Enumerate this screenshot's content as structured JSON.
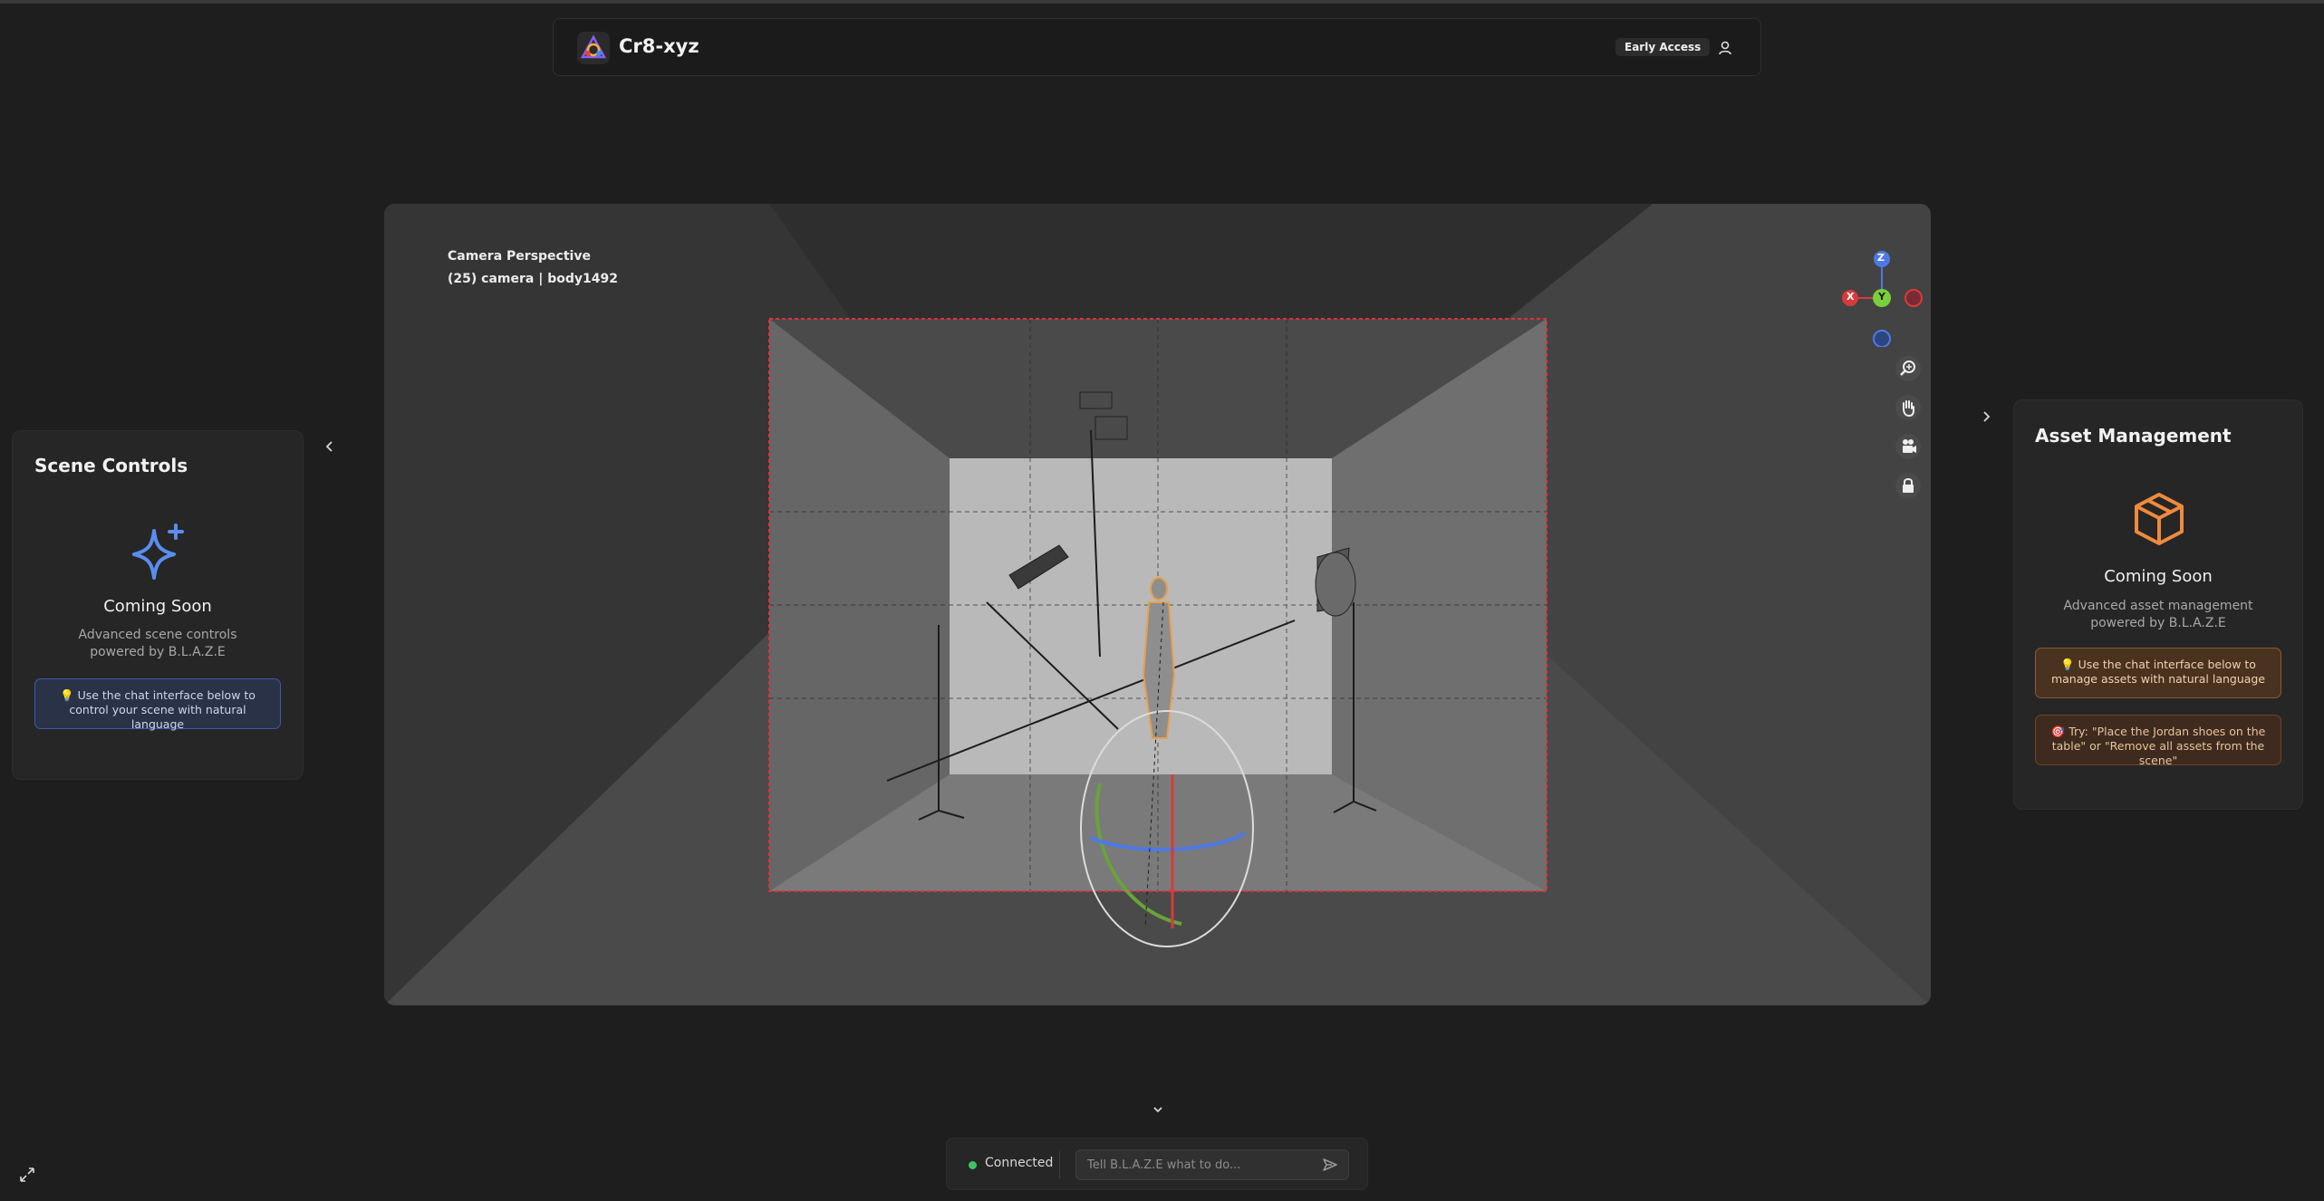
{
  "header": {
    "app_name": "Cr8-xyz",
    "badge": "Early Access"
  },
  "scene_controls": {
    "title": "Scene Controls",
    "coming_soon": "Coming Soon",
    "description": "Advanced scene controls powered by B.L.A.Z.E",
    "tip": "💡 Use the chat interface below to control your scene with natural language",
    "icon": "sparkles-icon"
  },
  "asset_management": {
    "title": "Asset Management",
    "coming_soon": "Coming Soon",
    "description": "Advanced asset management powered by B.L.A.Z.E",
    "tip": "💡 Use the chat interface below to manage assets with natural language",
    "try": "🎯 Try: \"Place the Jordan shoes on the table\" or \"Remove all assets from the scene\"",
    "icon": "box-icon",
    "accent": "#f08a3c"
  },
  "viewport": {
    "perspective_label": "Camera Perspective",
    "object_label": "(25) camera | body1492",
    "gizmo": {
      "z": "Z",
      "x": "X",
      "y": "Y"
    },
    "tools": [
      "zoom-icon",
      "pan-hand-icon",
      "camera-icon",
      "lock-icon"
    ],
    "frame_color": "#e0303c"
  },
  "chat": {
    "status": "Connected",
    "placeholder": "Tell B.L.A.Z.E what to do...",
    "status_color": "#40c463"
  }
}
